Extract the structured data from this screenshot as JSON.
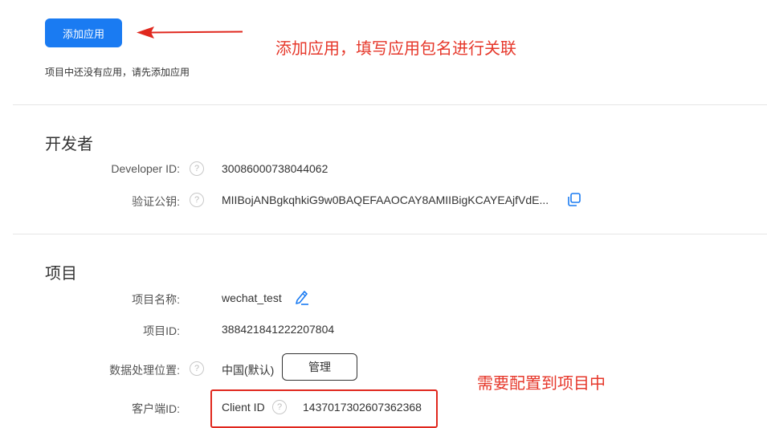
{
  "apps": {
    "add_button_label": "添加应用",
    "empty_tip": "项目中还没有应用，请先添加应用"
  },
  "annotations": {
    "add_app_note": "添加应用，填写应用包名进行关联",
    "config_note": "需要配置到项目中",
    "accent_color": "#e6372a"
  },
  "developer": {
    "title": "开发者",
    "developer_id_label": "Developer ID:",
    "developer_id_value": "30086000738044062",
    "public_key_label": "验证公钥:",
    "public_key_value": "MIIBojANBgkqhkiG9w0BAQEFAAOCAY8AMIIBigKCAYEAjfVdE..."
  },
  "project": {
    "title": "项目",
    "name_label": "项目名称:",
    "name_value": "wechat_test",
    "id_label": "项目ID:",
    "id_value": "388421841222207804",
    "location_label": "数据处理位置:",
    "location_value": "中国(默认)",
    "manage_button_label": "管理",
    "client_label": "客户端ID:",
    "client_id_label": "Client ID",
    "client_id_value": "1437017302607362368"
  },
  "colors": {
    "primary": "#1a7bf2",
    "icon_blue": "#1a7bf2"
  },
  "icons": {
    "help": "question-mark-circle",
    "copy": "copy-icon",
    "edit": "pencil-icon"
  }
}
